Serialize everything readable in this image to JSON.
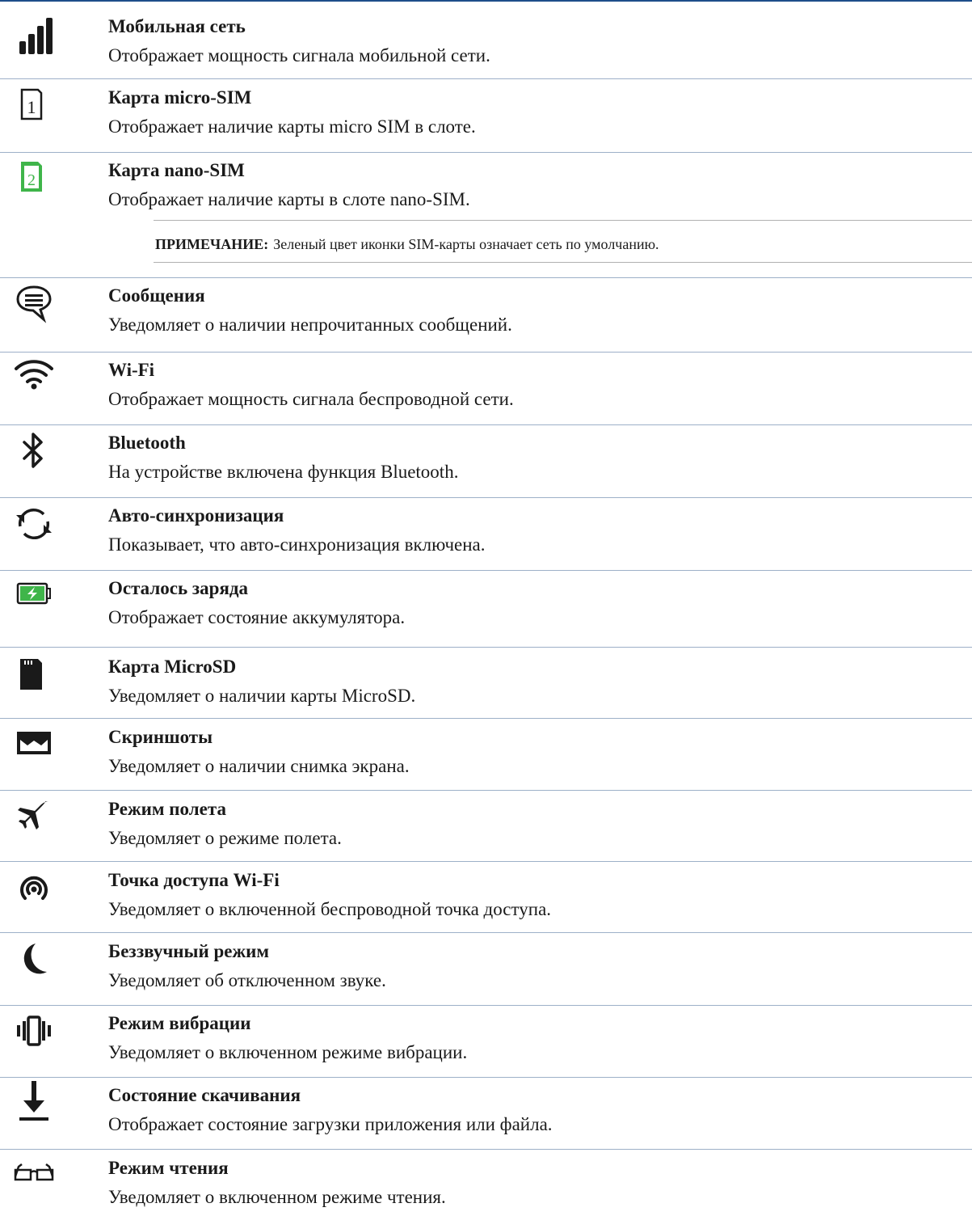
{
  "colors": {
    "rule": "#1d4e8a",
    "separator": "#9db0c8",
    "sim_green": "#3fb54a",
    "icon": "#1a1a1a"
  },
  "items": [
    {
      "icon": "signal-bars-icon",
      "title": "Мобильная сеть",
      "desc": "Отображает мощность сигнала мобильной сети."
    },
    {
      "icon": "sim-1-icon",
      "title": "Карта micro-SIM",
      "desc": "Отображает наличие карты micro SIM в слоте."
    },
    {
      "icon": "sim-2-icon",
      "title": "Карта nano-SIM",
      "desc": "Отображает наличие карты в слоте nano-SIM."
    },
    {
      "icon": "message-bubble-icon",
      "title": "Сообщения",
      "desc": "Уведомляет о наличии непрочитанных сообщений."
    },
    {
      "icon": "wifi-icon",
      "title": "Wi-Fi",
      "desc": "Отображает мощность сигнала беспроводной сети."
    },
    {
      "icon": "bluetooth-icon",
      "title": "Bluetooth",
      "desc": "На устройстве включена функция Bluetooth."
    },
    {
      "icon": "sync-icon",
      "title": "Авто-синхронизация",
      "desc": "Показывает, что авто-синхронизация включена."
    },
    {
      "icon": "battery-charging-icon",
      "title": "Осталось заряда",
      "desc": "Отображает состояние аккумулятора."
    },
    {
      "icon": "microsd-card-icon",
      "title": "Карта MicroSD",
      "desc": "Уведомляет о наличии карты MicroSD."
    },
    {
      "icon": "screenshot-icon",
      "title": "Скриншоты",
      "desc": "Уведомляет о наличии снимка экрана."
    },
    {
      "icon": "airplane-icon",
      "title": "Режим полета",
      "desc": "Уведомляет о режиме полета."
    },
    {
      "icon": "hotspot-icon",
      "title": "Точка доступа Wi-Fi",
      "desc": "Уведомляет о включенной беспроводной точка доступа."
    },
    {
      "icon": "moon-icon",
      "title": "Беззвучный режим",
      "desc": "Уведомляет об отключенном звуке."
    },
    {
      "icon": "vibration-icon",
      "title": "Режим вибрации",
      "desc": "Уведомляет о включенном режиме вибрации."
    },
    {
      "icon": "download-icon",
      "title": "Состояние скачивания",
      "desc": "Отображает состояние загрузки приложения или файла."
    },
    {
      "icon": "glasses-icon",
      "title": "Режим чтения",
      "desc": "Уведомляет о включенном режиме чтения."
    }
  ],
  "note": {
    "label": "ПРИМЕЧАНИЕ:",
    "text": "Зеленый цвет иконки SIM-карты означает сеть по умолчанию."
  }
}
